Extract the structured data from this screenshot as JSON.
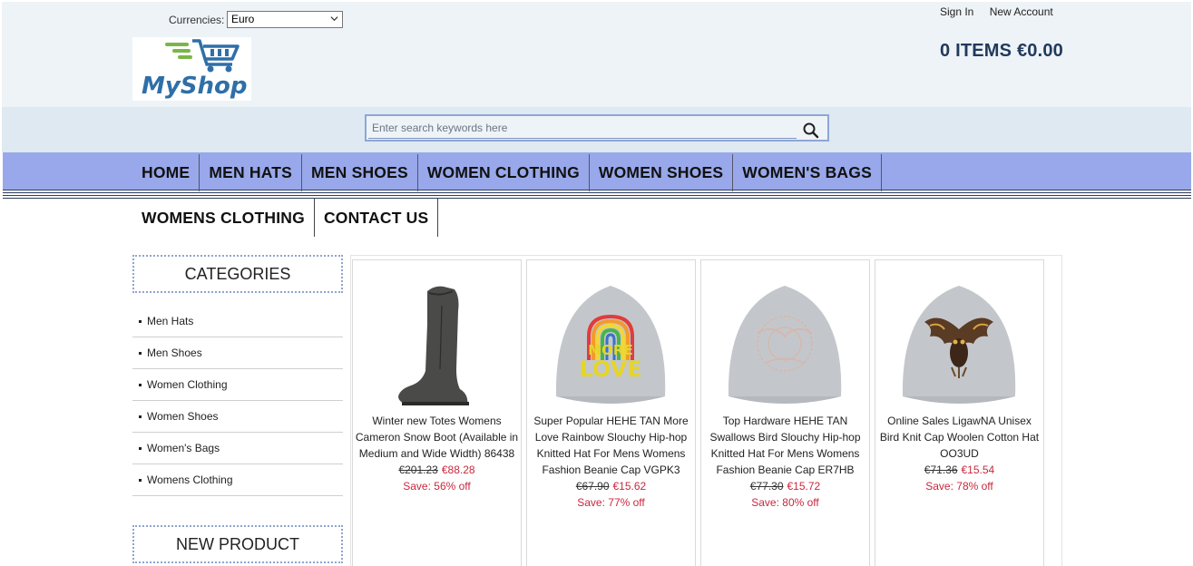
{
  "header": {
    "currency_label": "Currencies:",
    "currency_selected": "Euro",
    "sign_in": "Sign In",
    "new_account": "New Account",
    "cart_summary": "0 ITEMS €0.00",
    "logo_text": "MyShop"
  },
  "search": {
    "placeholder": "Enter search keywords here"
  },
  "nav": {
    "row1": [
      "HOME",
      "MEN HATS",
      "MEN SHOES",
      "WOMEN CLOTHING",
      "WOMEN SHOES",
      "WOMEN'S BAGS"
    ],
    "row2": [
      "WOMENS CLOTHING",
      "CONTACT US"
    ]
  },
  "sidebar": {
    "categories_title": "CATEGORIES",
    "categories": [
      "Men Hats",
      "Men Shoes",
      "Women Clothing",
      "Women Shoes",
      "Women's Bags",
      "Womens Clothing"
    ],
    "new_product_title": "NEW PRODUCT"
  },
  "products": [
    {
      "name": "Winter new Totes Womens Cameron Snow Boot (Available in Medium and Wide Width) 86438",
      "old_price": "€201.23",
      "new_price": "€88.28",
      "save": "Save: 56% off",
      "image": "boot-image"
    },
    {
      "name": "Super Popular HEHE TAN More Love Rainbow Slouchy Hip-hop Knitted Hat For Mens Womens Fashion Beanie Cap VGPK3",
      "old_price": "€67.90",
      "new_price": "€15.62",
      "save": "Save: 77% off",
      "image": "beanie-rainbow-image",
      "print_text_1": "MORE",
      "print_text_2": "LOVE"
    },
    {
      "name": "Top Hardware HEHE TAN Swallows Bird Slouchy Hip-hop Knitted Hat For Mens Womens Fashion Beanie Cap ER7HB",
      "old_price": "€77.30",
      "new_price": "€15.72",
      "save": "Save: 80% off",
      "image": "beanie-swallow-image"
    },
    {
      "name": "Online Sales LigawNA Unisex Bird Knit Cap Woolen Cotton Hat OO3UD",
      "old_price": "€71.36",
      "new_price": "€15.54",
      "save": "Save: 78% off",
      "image": "beanie-owl-image"
    }
  ],
  "colors": {
    "nav_bg": "#98a8ea",
    "header_bg": "#eef3f7",
    "search_band": "#dfe9f1",
    "sale_red": "#c8283d",
    "cart_text": "#213a5c"
  }
}
